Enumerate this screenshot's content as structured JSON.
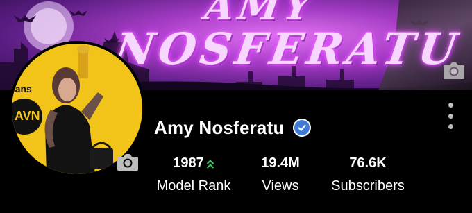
{
  "banner": {
    "title_line1": "AMY",
    "title_line2": "NOSFERATU"
  },
  "profile": {
    "name": "Amy Nosferatu",
    "verified": true
  },
  "stats": [
    {
      "value": "1987",
      "label": "Model Rank",
      "trend": "up"
    },
    {
      "value": "19.4M",
      "label": "Views"
    },
    {
      "value": "76.6K",
      "label": "Subscribers"
    }
  ],
  "icons": {
    "banner_camera": "camera-icon",
    "avatar_camera": "camera-icon",
    "verified": "verified-check-icon",
    "rank_trend": "double-chevron-up-icon",
    "more": "more-vertical-icon"
  },
  "colors": {
    "background": "#000000",
    "verified_blue": "#3f7bd6",
    "rank_up_green": "#2bd35e",
    "banner_purple": "#a53cc4"
  }
}
